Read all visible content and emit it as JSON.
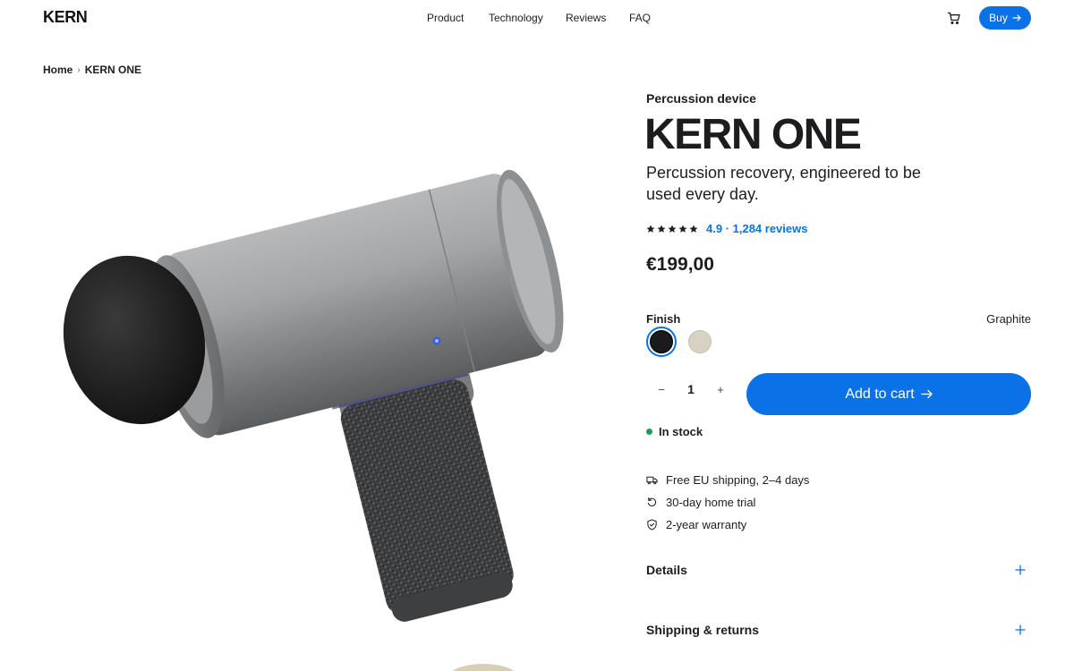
{
  "header": {
    "logo": "KERN",
    "nav": [
      "Product",
      "Technology",
      "Reviews",
      "FAQ"
    ],
    "buy_label": "Buy"
  },
  "breadcrumb": {
    "home": "Home",
    "current": "KERN ONE"
  },
  "product": {
    "eyebrow": "Percussion device",
    "name": "KERN ONE",
    "tagline": "Percussion recovery, engineered to be used every day.",
    "rating_value": 4.9,
    "rating_text": "4.9 · 1,284 reviews",
    "price": "€199,00"
  },
  "finish": {
    "label": "Finish",
    "selected": "Graphite",
    "swatch_colors": [
      "#1b1b1b",
      "#d8d2c4"
    ]
  },
  "cart": {
    "minus_symbol": "−",
    "quantity": "1",
    "plus_symbol": "+",
    "add_label": "Add to cart"
  },
  "stock": {
    "label": "In stock",
    "color": "#1f9d55"
  },
  "perks": [
    {
      "icon": "truck-icon",
      "text": "Free EU shipping, 2–4 days"
    },
    {
      "icon": "return-icon",
      "text": "30-day home trial"
    },
    {
      "icon": "shield-icon",
      "text": "2-year warranty"
    }
  ],
  "accordions": [
    {
      "title": "Details"
    },
    {
      "title": "Shipping & returns"
    }
  ],
  "colors": {
    "accent": "#0a72e6",
    "text": "#1d1d1f"
  }
}
